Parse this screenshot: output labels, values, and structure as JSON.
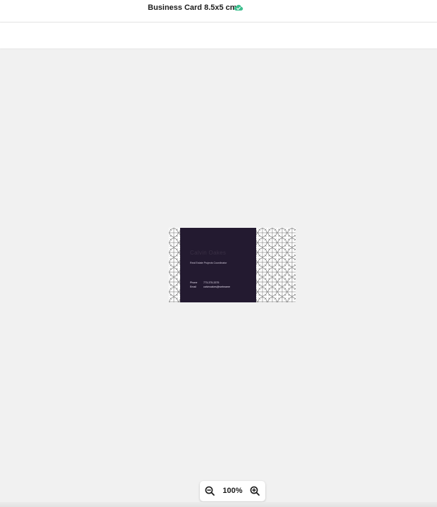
{
  "header": {
    "document_title": "Business Card 8.5x5 cm",
    "sync_icon": "cloud-check-icon",
    "sync_color": "#3fbf8f"
  },
  "card": {
    "name": "Calvin Oakes",
    "role": "Real Estate Projects Coordinator",
    "phone_label": "Phone",
    "phone_value": "773-375-3375",
    "email_label": "Email",
    "email_value": "calvinoakes@webname",
    "panel_color": "#231a30"
  },
  "zoom": {
    "level": "100%",
    "zoom_out_icon": "zoom-out-icon",
    "zoom_in_icon": "zoom-in-icon"
  }
}
